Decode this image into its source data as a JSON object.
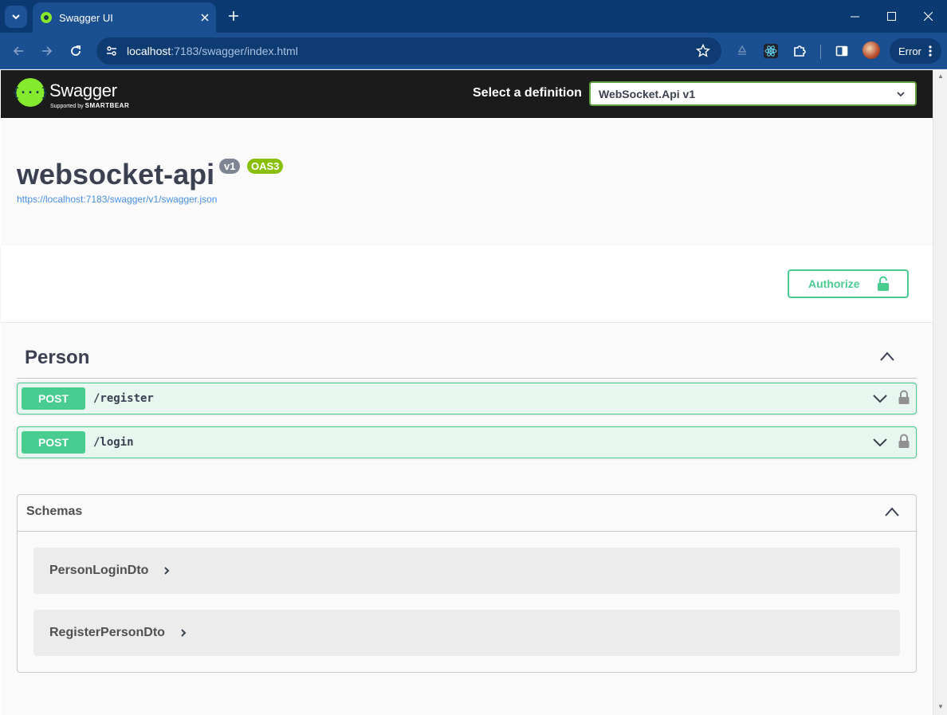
{
  "browser": {
    "tab_title": "Swagger UI",
    "url_host": "localhost",
    "url_path": ":7183/swagger/index.html",
    "profile_button_label": "Error"
  },
  "swagger": {
    "brand": "Swagger",
    "brand_sub_prefix": "Supported by",
    "brand_sub_company": "SMARTBEAR",
    "definition_label": "Select a definition",
    "definition_selected": "WebSocket.Api v1",
    "api_title": "websocket-api",
    "version_badge": "v1",
    "oas_badge": "OAS3",
    "spec_url": "https://localhost:7183/swagger/v1/swagger.json",
    "authorize_label": "Authorize",
    "tag_name": "Person",
    "operations": [
      {
        "method": "POST",
        "path": "/register"
      },
      {
        "method": "POST",
        "path": "/login"
      }
    ],
    "schemas_title": "Schemas",
    "models": [
      "PersonLoginDto",
      "RegisterPersonDto"
    ]
  },
  "colors": {
    "post_green": "#49cc90",
    "swagger_green": "#85ea2d",
    "topbar": "#1b1b1b",
    "chrome_blue": "#1a4f91"
  },
  "icons": {
    "tab_search": "chevron-down-icon",
    "favicon": "swagger-favicon-icon",
    "close": "close-icon",
    "new_tab": "plus-icon",
    "minimize": "minimize-icon",
    "maximize": "maximize-icon",
    "window_close": "window-close-icon",
    "back": "back-arrow-icon",
    "forward": "forward-arrow-icon",
    "reload": "reload-icon",
    "site_info": "tune-icon",
    "bookmark": "star-icon",
    "ext_recycle": "recycle-icon",
    "ext_react": "react-icon",
    "extensions": "puzzle-icon",
    "sidepanel": "side-panel-icon",
    "lock": "lock-icon"
  }
}
